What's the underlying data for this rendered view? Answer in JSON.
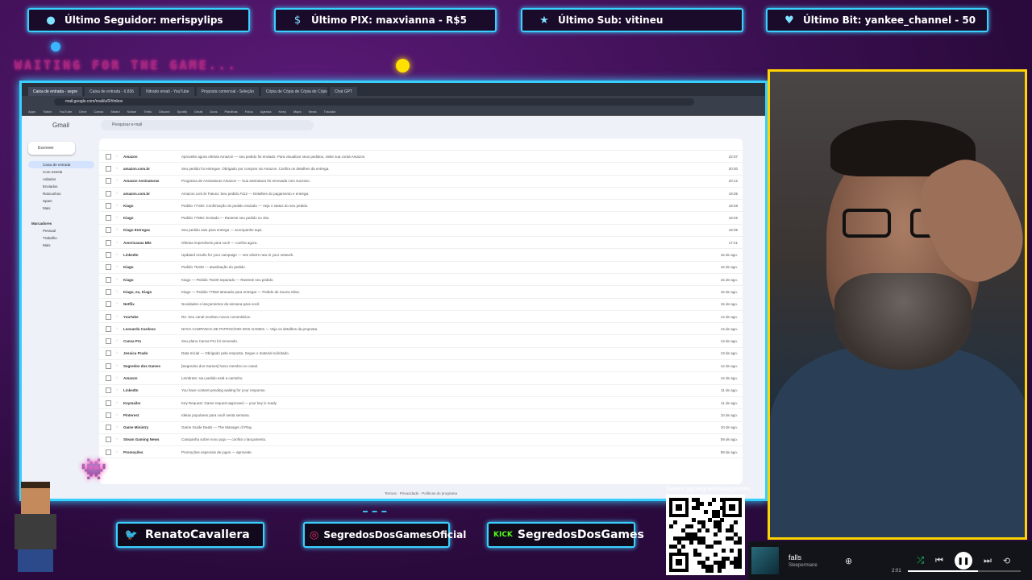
{
  "alerts": [
    {
      "icon": "user-icon",
      "label": "Último Seguidor: merispylips"
    },
    {
      "icon": "dollar-icon",
      "label": "Último PIX: maxvianna - R$5"
    },
    {
      "icon": "star-icon",
      "label": "Último Sub: vitineu"
    },
    {
      "icon": "diamond-icon",
      "label": "Último Bit: yankee_channel - 50"
    }
  ],
  "overlay": {
    "waiting_text": "WAITING FOR THE GAME..."
  },
  "browser": {
    "tabs": [
      "Caixa de entrada - segre",
      "Caixa de entrada - 6.836",
      "Nitrado email - YouTube",
      "Proposta comercial - Seleção",
      "Cópia de Cópia de Cópia de Cópia",
      "Chat GPT"
    ],
    "url": "mail.google.com/mail/u/0/#inbox",
    "bookmarks": [
      "Apps",
      "Twitch",
      "YouTube",
      "Drive",
      "Canva",
      "Steam",
      "Notion",
      "Trello",
      "Discord",
      "Spotify",
      "Gmail",
      "Docs",
      "Planilhas",
      "Fotos",
      "Agenda",
      "Keep",
      "Maps",
      "News",
      "Tradutor"
    ]
  },
  "gmail": {
    "logo": "Gmail",
    "search_placeholder": "Pesquisar e-mail",
    "compose": "Escrever",
    "nav": [
      "Caixa de entrada",
      "Com estrela",
      "Adiados",
      "Enviados",
      "Rascunhos",
      "Spam",
      "Mais",
      "Marcadores",
      "Pessoal",
      "Trabalho",
      "Mais"
    ],
    "rows": [
      {
        "sender": "Amazon",
        "subject": "Aproveite agora ofertas Amazon — seu pedido foi enviado. Para visualizar seus pedidos, visite sua conta Amazon.",
        "date": "22:07"
      },
      {
        "sender": "amazon.com.br",
        "subject": "Seu pedido foi entregue. Obrigado por comprar na Amazon. Confira os detalhes da entrega.",
        "date": "20:30"
      },
      {
        "sender": "Amazon Assinaturas",
        "subject": "Programa de Assinaturas Amazon — Sua assinatura foi renovada com sucesso.",
        "date": "20:12"
      },
      {
        "sender": "amazon.com.br",
        "subject": "Amazon.com.br Fatura: Seu pedido #112 — Detalhes do pagamento e entrega.",
        "date": "19:35"
      },
      {
        "sender": "Kiago",
        "subject": "Pedido 77430: Confirmação do pedido enviado — Veja o status do seu pedido.",
        "date": "18:48"
      },
      {
        "sender": "Kiago",
        "subject": "Pedido 77550: Enviado — Rastreie seu pedido no site.",
        "date": "18:45"
      },
      {
        "sender": "Kiago Entregas",
        "subject": "Seu pedido saiu para entrega — acompanhe aqui.",
        "date": "18:39"
      },
      {
        "sender": "Americanas Mkt",
        "subject": "Ofertas imperdíveis para você — confira agora.",
        "date": "17:21"
      },
      {
        "sender": "LinkedIn",
        "subject": "Updated results for your campaign — see what's new in your network.",
        "date": "16 de ago."
      },
      {
        "sender": "Kiago",
        "subject": "Pedido 76430 — atualização do pedido.",
        "date": "16 de ago."
      },
      {
        "sender": "Kiago",
        "subject": "Kiago — Pedido 76430 separado — Rastreie seu pedido.",
        "date": "15 de ago."
      },
      {
        "sender": "Kiago, eu, Kiago",
        "subject": "Kiago — Pedido 77550 atrasado para entregar — Pedido de Souza Silva.",
        "date": "15 de ago."
      },
      {
        "sender": "Netflix",
        "subject": "Novidades e lançamentos da semana para você.",
        "date": "15 de ago."
      },
      {
        "sender": "YouTube",
        "subject": "Re: Seu canal recebeu novos comentários.",
        "date": "14 de ago."
      },
      {
        "sender": "Leonardo Cardoso",
        "subject": "NOVA CAMPANHA DE PATROCÍNIO DOS GAMES — Veja os detalhes da proposta.",
        "date": "14 de ago."
      },
      {
        "sender": "Canva Pro",
        "subject": "Seu plano Canva Pro foi renovado.",
        "date": "13 de ago."
      },
      {
        "sender": "Jessica Prado",
        "subject": "Data Inicial — Obrigado pela resposta. Segue o material solicitado.",
        "date": "13 de ago."
      },
      {
        "sender": "Segredos dos Games",
        "subject": "[Segredos dos Games] Novo membro no canal.",
        "date": "12 de ago."
      },
      {
        "sender": "Amazon",
        "subject": "Lembrete: seu pedido está a caminho.",
        "date": "12 de ago."
      },
      {
        "sender": "LinkedIn",
        "subject": "You have content pending waiting for your response.",
        "date": "11 de ago."
      },
      {
        "sender": "Keymailer",
        "subject": "Key Request: Game request approved — your key is ready.",
        "date": "11 de ago."
      },
      {
        "sender": "Pinterest",
        "subject": "Ideias populares para você nesta semana.",
        "date": "10 de ago."
      },
      {
        "sender": "Game Ministry",
        "subject": "Game Guide Deals — The Manager of Play.",
        "date": "10 de ago."
      },
      {
        "sender": "Steam Gaming News",
        "subject": "Campanha sobre novo jogo — confira o lançamento.",
        "date": "09 de ago."
      },
      {
        "sender": "Promoções",
        "subject": "Promoções especiais de jogos — aproveite.",
        "date": "09 de ago."
      }
    ],
    "footer": "Termos · Privacidade · Políticas do programa"
  },
  "socials": [
    {
      "icon": "twitter-icon",
      "glyph": "🐦",
      "label": "RenatoCavallera",
      "color": "#1da1f2"
    },
    {
      "icon": "instagram-icon",
      "glyph": "◎",
      "label": "SegredosDosGamesOficial",
      "color": "#e1306c"
    },
    {
      "icon": "kick-icon",
      "glyph": "KICK",
      "label": "SegredosDosGames",
      "color": "#53fc18"
    }
  ],
  "qr": {
    "label": "livepix.gg/segredosdosgames"
  },
  "music": {
    "title": "falls",
    "artist": "Sleepermane",
    "elapsed": "2:01",
    "progress": 0.62
  }
}
